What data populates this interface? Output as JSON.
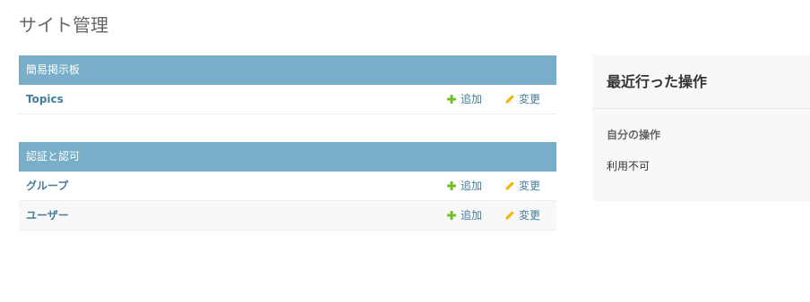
{
  "page": {
    "title": "サイト管理"
  },
  "modules": [
    {
      "caption": "簡易掲示板",
      "models": [
        {
          "name": "Topics",
          "add_label": "追加",
          "change_label": "変更"
        }
      ]
    },
    {
      "caption": "認証と認可",
      "models": [
        {
          "name": "グループ",
          "add_label": "追加",
          "change_label": "変更"
        },
        {
          "name": "ユーザー",
          "add_label": "追加",
          "change_label": "変更"
        }
      ]
    }
  ],
  "recent_actions": {
    "title": "最近行った操作",
    "subtitle": "自分の操作",
    "empty_text": "利用不可"
  },
  "colors": {
    "caption_bg": "#79aec8",
    "link": "#447e9b",
    "add_icon": "#70bf2b",
    "change_icon": "#efb80b"
  },
  "icons": {
    "add": "plus-icon",
    "change": "pencil-icon"
  }
}
